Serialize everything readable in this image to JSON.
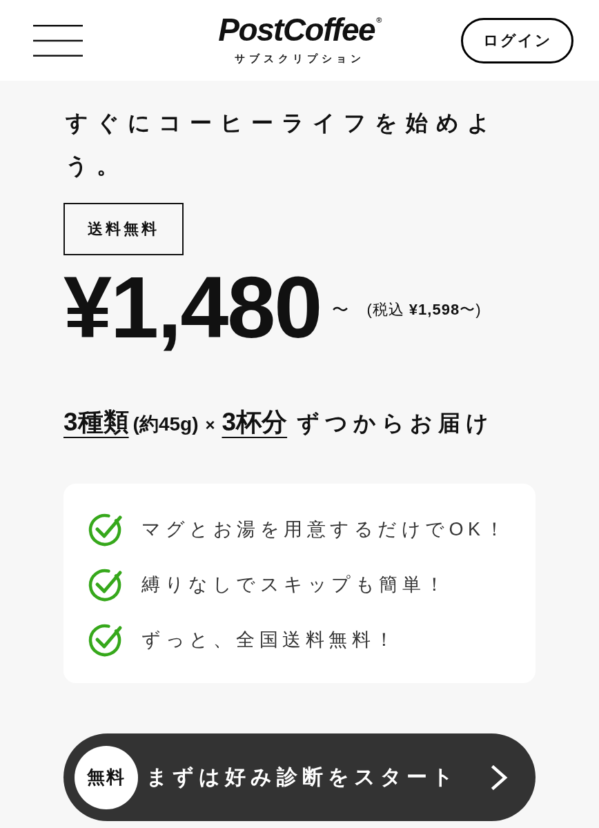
{
  "header": {
    "logo": {
      "wordmark": "PostCoffee$^{®}$",
      "tagline": "サブスクリプション"
    },
    "login_button": "ログイン"
  },
  "hero": {
    "heading": "すぐにコーヒーライフを始めよう。",
    "badge": "送料無料",
    "price": "¥1,480",
    "price_suffix": "〜",
    "tax_note": "(税込 **¥1,598**〜)"
  },
  "delivery": [
    {
      "kind": "emphasis",
      "text": "3種類"
    },
    {
      "kind": "note",
      "text": "(約45g)"
    },
    {
      "kind": "symbol",
      "text": "×"
    },
    {
      "kind": "emphasis",
      "text": "3杯分"
    },
    {
      "kind": "plain",
      "text": "ずつからお届け"
    }
  ],
  "features": [
    {
      "text": "マグとお湯を用意するだけでOK！"
    },
    {
      "text": "縛りなしでスキップも簡単！"
    },
    {
      "text": "ずっと、全国送料無料！"
    }
  ],
  "cta": {
    "badge": "無料",
    "label": "まずは好み診断をスタート"
  }
}
